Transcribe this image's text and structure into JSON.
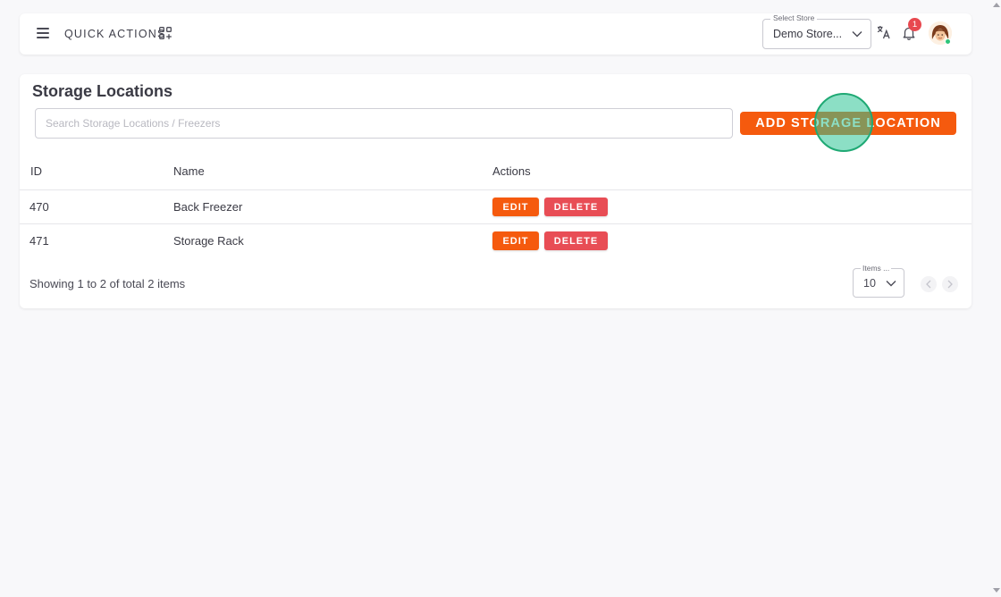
{
  "topbar": {
    "quick_actions_label": "QUICK ACTIONS",
    "store_select": {
      "legend": "Select Store",
      "value": "Demo Store..."
    },
    "notification_count": "1"
  },
  "storage": {
    "title": "Storage Locations",
    "search_placeholder": "Search Storage Locations / Freezers",
    "add_button_label": "ADD STORAGE LOCATION",
    "columns": {
      "id": "ID",
      "name": "Name",
      "actions": "Actions"
    },
    "rows": [
      {
        "id": "470",
        "name": "Back Freezer",
        "edit_label": "EDIT",
        "delete_label": "DELETE"
      },
      {
        "id": "471",
        "name": "Storage Rack",
        "edit_label": "EDIT",
        "delete_label": "DELETE"
      }
    ],
    "showing_text": "Showing 1 to 2 of total 2 items",
    "items_per_page": {
      "legend": "Items ...",
      "value": "10"
    }
  },
  "colors": {
    "accent": "#f55a0e",
    "danger": "#e84d55",
    "badge": "#e8484f",
    "online": "#2ec47a"
  },
  "icons": [
    "menu-icon",
    "quick-actions-grid-icon",
    "chevron-down-icon",
    "translate-icon",
    "bell-icon",
    "avatar",
    "chevron-left-icon",
    "chevron-right-icon"
  ]
}
